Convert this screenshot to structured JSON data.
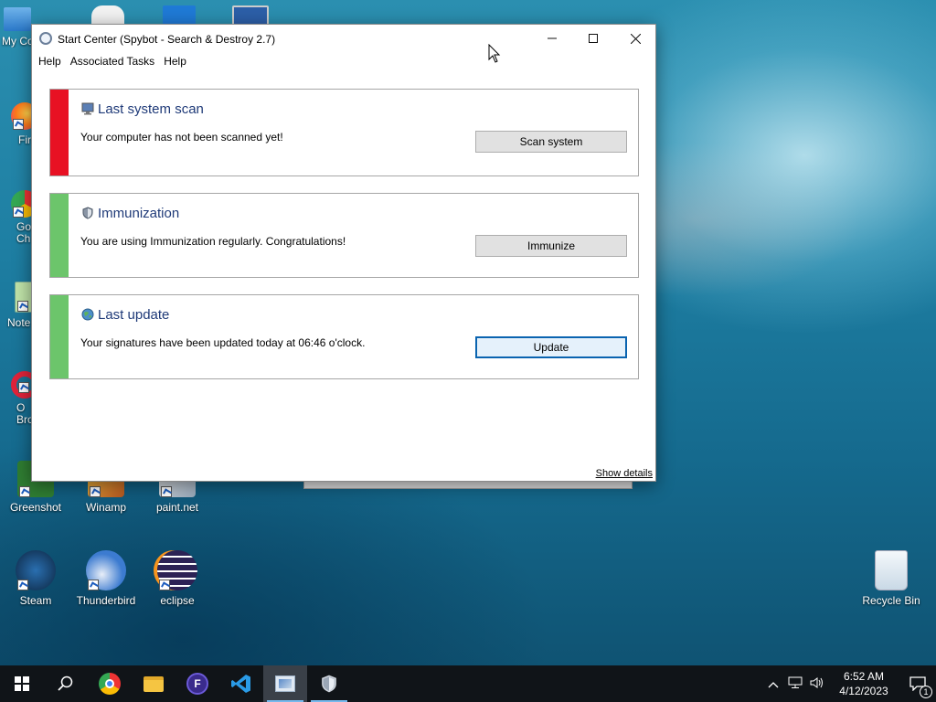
{
  "desktop": {
    "icons": [
      {
        "label": "My Co",
        "id": "this-pc"
      },
      {
        "label": "Fir",
        "id": "firefox"
      },
      {
        "label": "Go\nCh",
        "id": "chrome"
      },
      {
        "label": "Note",
        "id": "notepad"
      },
      {
        "label": "O\nBro",
        "id": "opera"
      },
      {
        "label": "Greenshot",
        "id": "greenshot"
      },
      {
        "label": "Winamp",
        "id": "winamp"
      },
      {
        "label": "paint.net",
        "id": "paintnet"
      },
      {
        "label": "Steam",
        "id": "steam"
      },
      {
        "label": "Thunderbird",
        "id": "thunderbird"
      },
      {
        "label": "eclipse",
        "id": "eclipse"
      },
      {
        "label": "Recycle Bin",
        "id": "recycle-bin"
      }
    ]
  },
  "window": {
    "title": "Start Center (Spybot - Search & Destroy 2.7)",
    "menu": [
      "Help",
      "Associated Tasks",
      "Help"
    ],
    "panels": [
      {
        "title": "Last system scan",
        "text": "Your computer has not been scanned yet!",
        "button": "Scan system",
        "status_color": "#e81123",
        "icon": "monitor-icon"
      },
      {
        "title": "Immunization",
        "text": "You are using Immunization regularly. Congratulations!",
        "button": "Immunize",
        "status_color": "#6cc56b",
        "icon": "shield-icon"
      },
      {
        "title": "Last update",
        "text": "Your signatures have been updated today at 06:46 o'clock.",
        "button": "Update",
        "status_color": "#6cc56b",
        "icon": "globe-icon"
      }
    ],
    "show_details": "Show details"
  },
  "taskbar": {
    "apps": [
      "start",
      "search",
      "chrome",
      "file-explorer",
      "fdm",
      "vscode",
      "spybot-start-center",
      "spybot-shield"
    ],
    "clock_time": "6:52 AM",
    "clock_date": "4/12/2023",
    "notification_count": "1"
  }
}
